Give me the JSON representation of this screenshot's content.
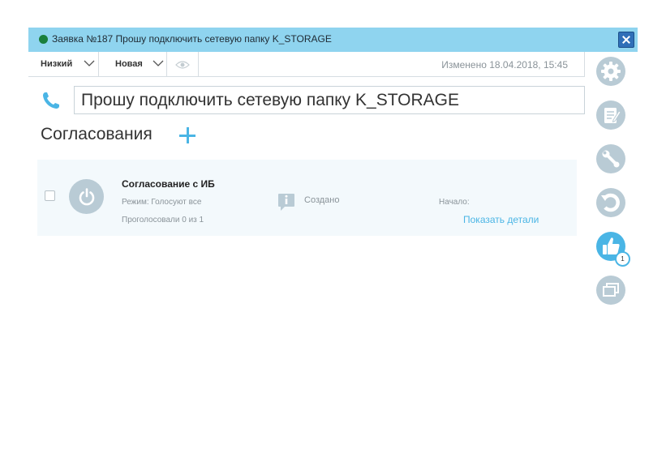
{
  "window": {
    "title": "Заявка №187 Прошу подключить сетевую папку K_STORAGE",
    "status_color": "#1a7f3c",
    "accent_color": "#4ab5e5",
    "titlebar_color": "#8fd4ef"
  },
  "toolbar": {
    "priority": "Низкий",
    "status": "Новая",
    "modified": "Изменено 18.04.2018, 15:45"
  },
  "request": {
    "subject": "Прошу подключить сетевую папку K_STORAGE"
  },
  "approvals": {
    "section_title": "Согласования",
    "items": [
      {
        "title": "Согласование с ИБ",
        "mode": "Режим: Голосуют все",
        "votes": "Проголосовали 0 из 1",
        "state": "Создано",
        "start": "Начало:",
        "details_link": "Показать детали"
      }
    ]
  },
  "sidebar": {
    "items": [
      {
        "icon": "gear-icon"
      },
      {
        "icon": "notepad-icon"
      },
      {
        "icon": "wrench-icon"
      },
      {
        "icon": "undo-icon"
      },
      {
        "icon": "thumbs-up-icon",
        "badge": "1"
      },
      {
        "icon": "windows-icon"
      }
    ]
  }
}
